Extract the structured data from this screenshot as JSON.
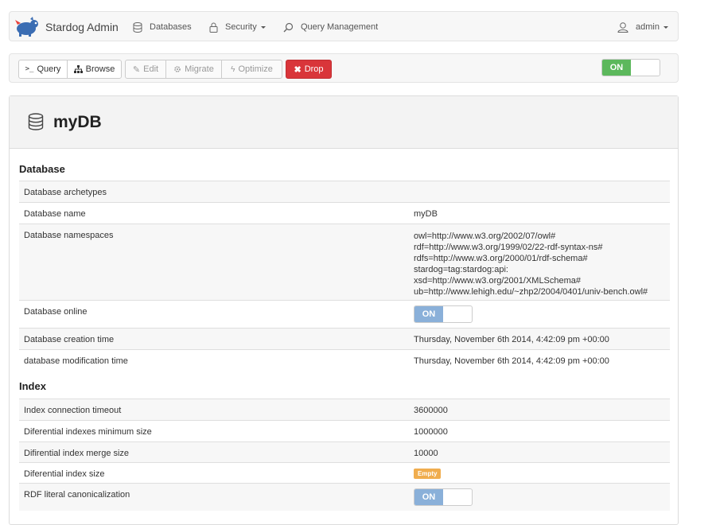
{
  "navbar": {
    "brand": "Stardog Admin",
    "items": [
      {
        "label": "Databases",
        "icon": "database-icon"
      },
      {
        "label": "Security",
        "icon": "lock-icon"
      },
      {
        "label": "Query Management",
        "icon": "search-icon"
      }
    ],
    "user": "admin"
  },
  "toolbar": {
    "query": "Query",
    "browse": "Browse",
    "edit": "Edit",
    "migrate": "Migrate",
    "optimize": "Optimize",
    "drop": "Drop",
    "online_toggle": "ON"
  },
  "db": {
    "title": "myDB",
    "section_database": "Database",
    "section_index": "Index",
    "database_rows": [
      {
        "key": "Database archetypes",
        "value": ""
      },
      {
        "key": "Database name",
        "value": "myDB"
      },
      {
        "key": "Database namespaces",
        "value": "owl=http://www.w3.org/2002/07/owl#\nrdf=http://www.w3.org/1999/02/22-rdf-syntax-ns#\nrdfs=http://www.w3.org/2000/01/rdf-schema#\nstardog=tag:stardog:api:\nxsd=http://www.w3.org/2001/XMLSchema#\nub=http://www.lehigh.edu/~zhp2/2004/0401/univ-bench.owl#"
      },
      {
        "key": "Database online",
        "value": "ON"
      },
      {
        "key": "Database creation time",
        "value": "Thursday, November 6th 2014, 4:42:09 pm +00:00"
      },
      {
        "key": "database modification time",
        "value": "Thursday, November 6th 2014, 4:42:09 pm +00:00"
      }
    ],
    "index_rows": [
      {
        "key": "Index connection timeout",
        "value": "3600000"
      },
      {
        "key": "Diferential indexes minimum size",
        "value": "1000000"
      },
      {
        "key": "Difirential index merge size",
        "value": "10000"
      },
      {
        "key": "Diferential index size",
        "value": "Empty"
      },
      {
        "key": "RDF literal canonicalization",
        "value": "ON"
      }
    ]
  },
  "colors": {
    "drop": "#d9353a",
    "toggle_on_green": "#5cb85c",
    "toggle_on_blue": "#8ab0d9",
    "badge_empty": "#f0ad4e"
  }
}
